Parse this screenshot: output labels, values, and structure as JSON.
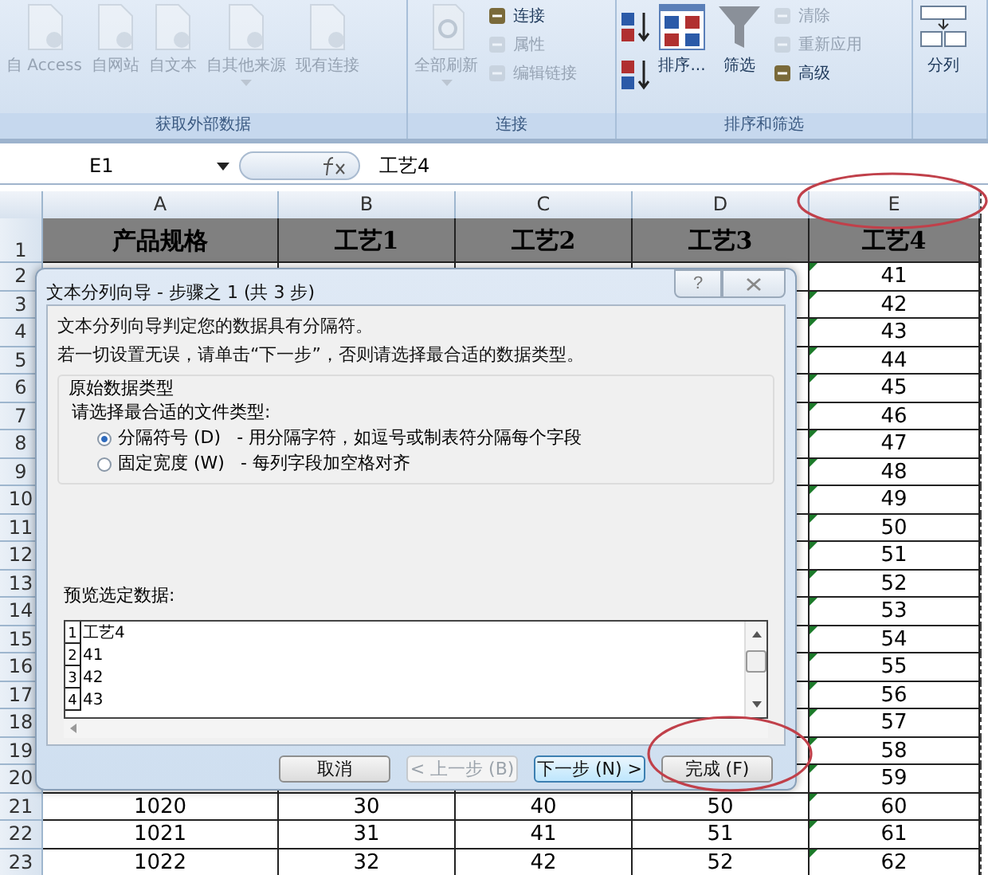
{
  "ribbon": {
    "groups": [
      {
        "label": "获取外部数据",
        "items": [
          {
            "kind": "large",
            "label": "自 Access",
            "disabled": true
          },
          {
            "kind": "large",
            "label": "自网站",
            "disabled": true
          },
          {
            "kind": "large",
            "label": "自文本",
            "disabled": true
          },
          {
            "kind": "large",
            "label": "自其他来源",
            "disabled": true,
            "dropdown": true
          },
          {
            "kind": "large",
            "label": "现有连接",
            "disabled": true
          }
        ]
      },
      {
        "label": "连接",
        "items": [
          {
            "kind": "large",
            "label": "全部刷新",
            "disabled": true,
            "dropdown": true
          },
          {
            "kind": "small",
            "label": "连接",
            "disabled": false
          },
          {
            "kind": "small",
            "label": "属性",
            "disabled": true
          },
          {
            "kind": "small",
            "label": "编辑链接",
            "disabled": true
          }
        ]
      },
      {
        "label": "排序和筛选",
        "items": [
          {
            "kind": "sort-pair",
            "disabled": false
          },
          {
            "kind": "large",
            "label": "排序...",
            "disabled": false
          },
          {
            "kind": "large",
            "label": "筛选",
            "disabled": false
          },
          {
            "kind": "small",
            "label": "清除",
            "disabled": true
          },
          {
            "kind": "small",
            "label": "重新应用",
            "disabled": true
          },
          {
            "kind": "small",
            "label": "高级",
            "disabled": false
          }
        ]
      },
      {
        "items": [
          {
            "kind": "large",
            "label": "分列",
            "disabled": false
          }
        ]
      }
    ]
  },
  "formula_bar": {
    "name_box": "E1",
    "formula": "工艺4"
  },
  "sheet": {
    "columns": [
      "A",
      "B",
      "C",
      "D",
      "E"
    ],
    "rows": [
      {
        "number": "1",
        "header": true,
        "cells": {
          "A": "产品规格",
          "B": "工艺1",
          "C": "工艺2",
          "D": "工艺3",
          "E": "工艺4"
        }
      },
      {
        "number": "2",
        "flagged": true,
        "cells": {
          "E": "41"
        }
      },
      {
        "number": "3",
        "flagged": true,
        "cells": {
          "E": "42"
        }
      },
      {
        "number": "4",
        "flagged": true,
        "cells": {
          "E": "43"
        }
      },
      {
        "number": "5",
        "flagged": true,
        "cells": {
          "E": "44"
        }
      },
      {
        "number": "6",
        "flagged": true,
        "cells": {
          "E": "45"
        }
      },
      {
        "number": "7",
        "flagged": true,
        "cells": {
          "E": "46"
        }
      },
      {
        "number": "8",
        "flagged": true,
        "cells": {
          "E": "47"
        }
      },
      {
        "number": "9",
        "flagged": true,
        "cells": {
          "E": "48"
        }
      },
      {
        "number": "10",
        "flagged": true,
        "cells": {
          "E": "49"
        }
      },
      {
        "number": "11",
        "flagged": true,
        "cells": {
          "E": "50"
        }
      },
      {
        "number": "12",
        "flagged": true,
        "cells": {
          "E": "51"
        }
      },
      {
        "number": "13",
        "flagged": true,
        "cells": {
          "E": "52"
        }
      },
      {
        "number": "14",
        "flagged": true,
        "cells": {
          "E": "53"
        }
      },
      {
        "number": "15",
        "flagged": true,
        "cells": {
          "E": "54"
        }
      },
      {
        "number": "16",
        "flagged": true,
        "cells": {
          "E": "55"
        }
      },
      {
        "number": "17",
        "flagged": true,
        "cells": {
          "E": "56"
        }
      },
      {
        "number": "18",
        "flagged": true,
        "cells": {
          "E": "57"
        }
      },
      {
        "number": "19",
        "flagged": true,
        "cells": {
          "E": "58"
        }
      },
      {
        "number": "20",
        "flagged": true,
        "cells": {
          "E": "59"
        }
      },
      {
        "number": "21",
        "flagged": true,
        "cells": {
          "A": "1020",
          "B": "30",
          "C": "40",
          "D": "50",
          "E": "60"
        }
      },
      {
        "number": "22",
        "flagged": true,
        "cells": {
          "A": "1021",
          "B": "31",
          "C": "41",
          "D": "51",
          "E": "61"
        }
      },
      {
        "number": "23",
        "flagged": true,
        "cells": {
          "A": "1022",
          "B": "32",
          "C": "42",
          "D": "52",
          "E": "62"
        }
      }
    ]
  },
  "dialog": {
    "title": "文本分列向导 - 步骤之 1 (共 3 步)",
    "help": "?",
    "lines": [
      "文本分列向导判定您的数据具有分隔符。",
      "若一切设置无误，请单击“下一步”，否则请选择最合适的数据类型。"
    ],
    "group_title": "原始数据类型",
    "group_prompt": "请选择最合适的文件类型:",
    "options": [
      {
        "label": "分隔符号 (D)",
        "description": "- 用分隔字符，如逗号或制表符分隔每个字段",
        "selected": true
      },
      {
        "label": "固定宽度 (W)",
        "description": "- 每列字段加空格对齐",
        "selected": false
      }
    ],
    "preview_label": "预览选定数据:",
    "preview_rows": [
      {
        "number": "1",
        "text": "工艺4"
      },
      {
        "number": "2",
        "text": "41"
      },
      {
        "number": "3",
        "text": "42"
      },
      {
        "number": "4",
        "text": "43"
      }
    ],
    "buttons": [
      {
        "label": "取消",
        "disabled": false,
        "default": false
      },
      {
        "label": "< 上一步 (B)",
        "disabled": true,
        "default": false
      },
      {
        "label": "下一步 (N) >",
        "disabled": false,
        "default": true
      },
      {
        "label": "完成 (F)",
        "disabled": false,
        "default": false
      }
    ]
  }
}
